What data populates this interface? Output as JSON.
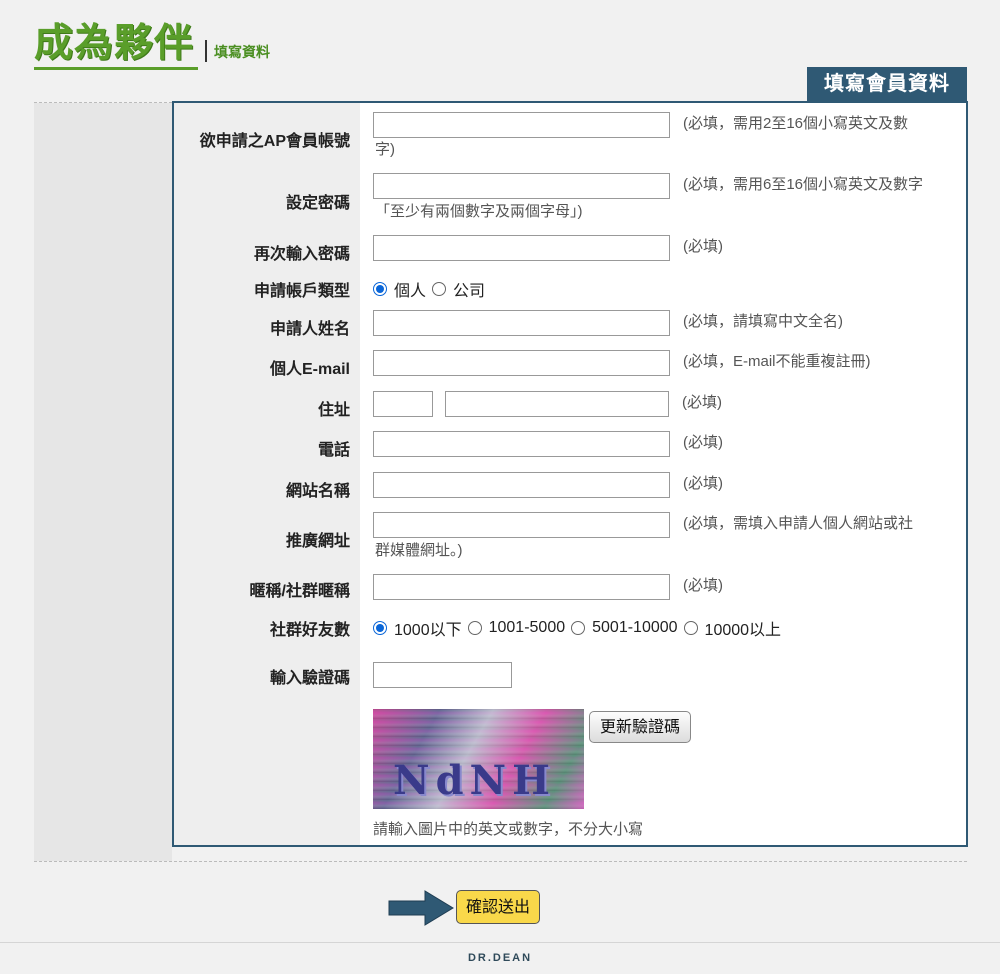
{
  "header": {
    "logo_main": "成為夥伴",
    "logo_sub": "填寫資料"
  },
  "section_title": "填寫會員資料",
  "form": {
    "account": {
      "label": "欲申請之AP會員帳號",
      "hint_line1": "(必填，需用2至16個小寫英文及數",
      "hint_line2": "字)"
    },
    "password": {
      "label": "設定密碼",
      "hint_line1": "(必填，需用6至16個小寫英文及數字",
      "hint_line2": "「至少有兩個數字及兩個字母」)"
    },
    "password_confirm": {
      "label": "再次輸入密碼",
      "hint": "(必填)"
    },
    "account_type": {
      "label": "申請帳戶類型",
      "options": [
        "個人",
        "公司"
      ],
      "selected": "個人"
    },
    "name": {
      "label": "申請人姓名",
      "hint": "(必填，請填寫中文全名)"
    },
    "email": {
      "label": "個人E-mail",
      "hint": "(必填，E-mail不能重複註冊)"
    },
    "address": {
      "label": "住址",
      "hint": "(必填)"
    },
    "phone": {
      "label": "電話",
      "hint": "(必填)"
    },
    "site_name": {
      "label": "網站名稱",
      "hint": "(必填)"
    },
    "site_url": {
      "label": "推廣網址",
      "hint_line1": "(必填，需填入申請人個人網站或社",
      "hint_line2": "群媒體網址。)"
    },
    "nickname": {
      "label": "暱稱/社群暱稱",
      "hint": "(必填)"
    },
    "friends": {
      "label": "社群好友數",
      "options": [
        "1000以下",
        "1001-5000",
        "5001-10000",
        "10000以上"
      ],
      "selected": "1000以下"
    },
    "captcha": {
      "label": "輸入驗證碼",
      "image_text": "NdNH",
      "refresh_label": "更新驗證碼",
      "note": "請輸入圖片中的英文或數字，不分大小寫"
    }
  },
  "submit_label": "確認送出",
  "footer_logo": "DR.DEAN",
  "colors": {
    "accent": "#2f5974",
    "logo_green": "#5a9e2a",
    "submit_bg": "#f9d84a",
    "radio_checked": "#0a66d8"
  }
}
